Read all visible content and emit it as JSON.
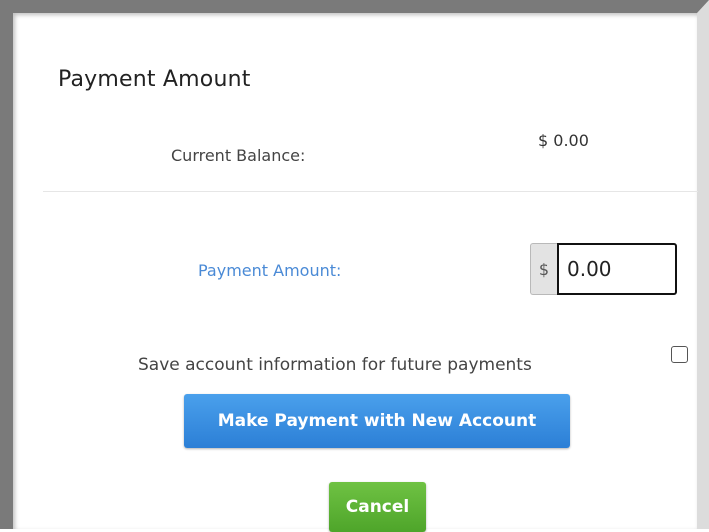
{
  "panel": {
    "title": "Payment Amount"
  },
  "balance": {
    "label": "Current Balance:",
    "value": "$ 0.00"
  },
  "payment": {
    "label": "Payment Amount:",
    "currency_symbol": "$",
    "value": "0.00"
  },
  "save_account": {
    "label": "Save account information for future payments",
    "checked": false
  },
  "buttons": {
    "make_payment": "Make Payment with New Account",
    "cancel": "Cancel"
  },
  "colors": {
    "label_accent": "#4a8ad6",
    "primary_button": "#2c7fd6",
    "cancel_button": "#4ea52a"
  }
}
